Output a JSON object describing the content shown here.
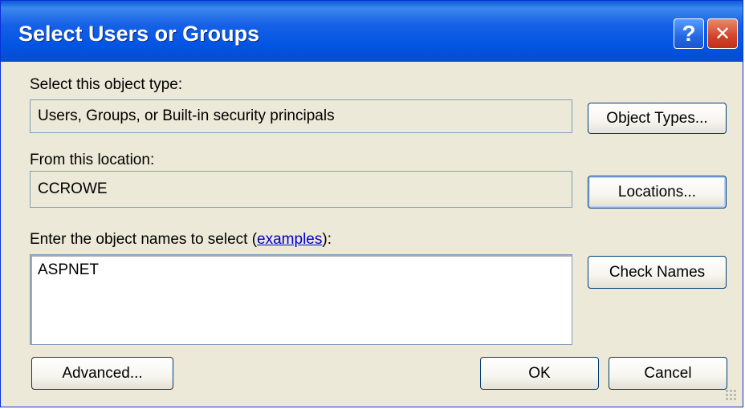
{
  "window": {
    "title": "Select Users or Groups",
    "help_glyph": "?",
    "close_glyph": "✕"
  },
  "object_type": {
    "label": "Select this object type:",
    "value": "Users, Groups, or Built-in security principals",
    "button": "Object Types..."
  },
  "location": {
    "label": "From this location:",
    "value": "CCROWE",
    "button": "Locations..."
  },
  "names": {
    "label_prefix": "Enter the object names to select (",
    "link": "examples",
    "label_suffix": "):",
    "value": "ASPNET",
    "button": "Check Names"
  },
  "footer": {
    "advanced": "Advanced...",
    "ok": "OK",
    "cancel": "Cancel"
  }
}
